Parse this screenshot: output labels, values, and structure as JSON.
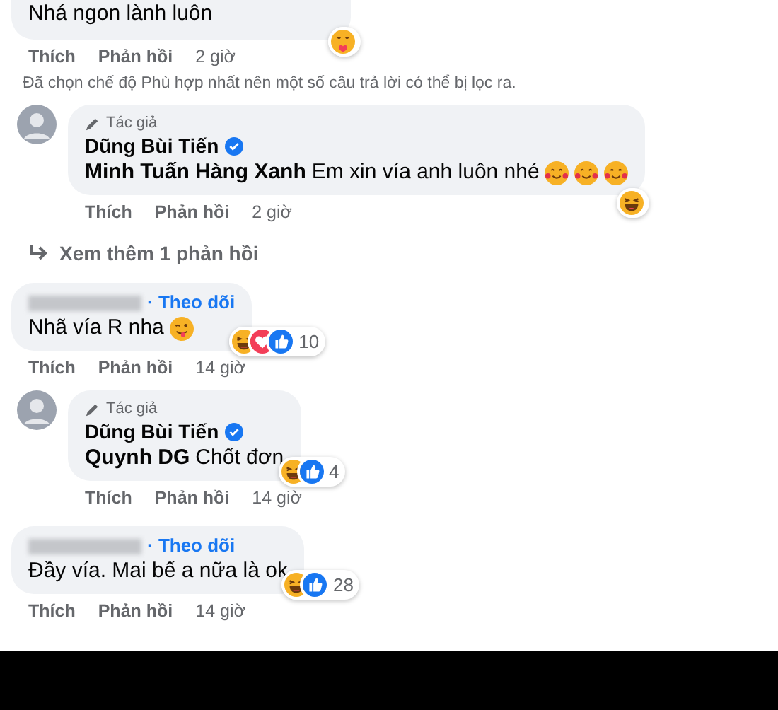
{
  "thread": [
    {
      "kind": "comment",
      "cut": true,
      "text": "Nhá ngon lành luôn",
      "reactions": [
        {
          "kind": "hug"
        }
      ],
      "actions": [
        "Thích",
        "Phản hồi"
      ],
      "time": "2 giờ"
    },
    {
      "kind": "note",
      "text": "Đã chọn chế độ Phù hợp nhất nên một số câu trả lời có thể bị lọc ra."
    },
    {
      "kind": "reply",
      "badge": "Tác giả",
      "name": "Dũng Bùi Tiến",
      "verified": true,
      "mention": "Minh Tuấn Hàng Xanh",
      "text": "Em xin vía anh luôn nhé",
      "emoji": [
        {
          "kind": "hearts"
        },
        {
          "kind": "hearts"
        },
        {
          "kind": "hearts"
        }
      ],
      "reactions": [
        {
          "kind": "haha"
        }
      ],
      "actions": [
        "Thích",
        "Phản hồi"
      ],
      "time": "2 giờ"
    },
    {
      "kind": "more",
      "text": "Xem thêm 1 phản hồi"
    },
    {
      "kind": "comment",
      "cut": false,
      "follow": "· Theo dõi",
      "text": "Nhã vía R nha",
      "emoji": [
        {
          "kind": "wink"
        }
      ],
      "reactions": [
        {
          "kind": "haha"
        },
        {
          "kind": "love"
        },
        {
          "kind": "like"
        }
      ],
      "count": "10",
      "actions": [
        "Thích",
        "Phản hồi"
      ],
      "time": "14 giờ"
    },
    {
      "kind": "reply",
      "badge": "Tác giả",
      "name": "Dũng Bùi Tiến",
      "verified": true,
      "mention": "Quynh DG",
      "text": "Chốt đơn",
      "reactions": [
        {
          "kind": "haha"
        },
        {
          "kind": "like"
        }
      ],
      "count": "4",
      "actions": [
        "Thích",
        "Phản hồi"
      ],
      "time": "14 giờ"
    },
    {
      "kind": "comment",
      "cut": false,
      "follow": "· Theo dõi",
      "text": "Đầy vía. Mai bế a nữa là ok",
      "reactions": [
        {
          "kind": "haha"
        },
        {
          "kind": "like"
        }
      ],
      "count": "28",
      "actions": [
        "Thích",
        "Phản hồi"
      ],
      "time": "14 giờ"
    }
  ]
}
